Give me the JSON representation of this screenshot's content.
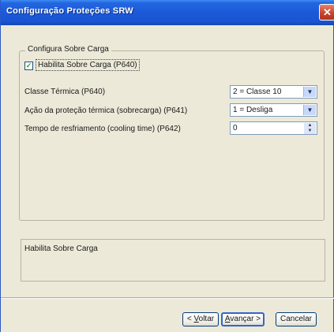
{
  "window": {
    "title": "Configuração Proteções SRW",
    "close_glyph": "✕"
  },
  "group": {
    "legend": "Configura Sobre Carga",
    "checkbox": {
      "label": "Habilita Sobre Carga (P640)",
      "checked": true
    }
  },
  "fields": [
    {
      "label": "Classe Térmica (P640)",
      "value": "2 = Classe 10",
      "control": "select"
    },
    {
      "label": "Ação da proteção térmica (sobrecarga) (P641)",
      "value": "1 = Desliga",
      "control": "select"
    },
    {
      "label": "Tempo de resfriamento (cooling time) (P642)",
      "value": "0",
      "control": "spin"
    }
  ],
  "description": {
    "text": "Habilita Sobre Carga"
  },
  "buttons": {
    "back": {
      "pre": "< ",
      "mnemonic": "V",
      "rest": "oltar"
    },
    "next": {
      "mnemonic": "A",
      "rest": "vançar >"
    },
    "cancel": {
      "label": "Cancelar"
    }
  }
}
